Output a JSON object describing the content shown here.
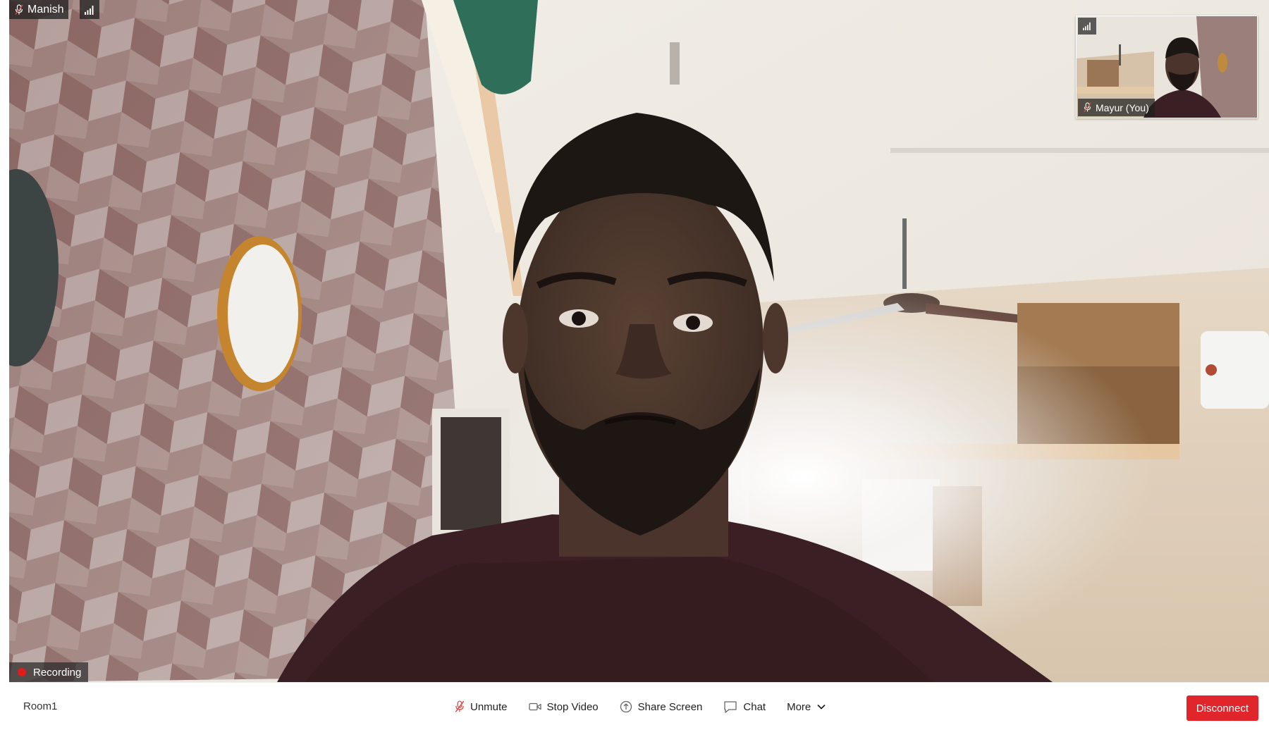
{
  "main_video": {
    "participant_name": "Manish",
    "recording_label": "Recording"
  },
  "self_view": {
    "participant_name": "Mayur (You)"
  },
  "toolbar": {
    "room_name": "Room1",
    "unmute_label": "Unmute",
    "stop_video_label": "Stop Video",
    "share_screen_label": "Share Screen",
    "chat_label": "Chat",
    "more_label": "More",
    "disconnect_label": "Disconnect"
  },
  "icons": {
    "mic": "mic-muted-icon",
    "video": "camera-icon",
    "share": "share-screen-icon",
    "chat": "chat-bubble-icon",
    "more": "chevron-down-icon",
    "signal": "signal-bars-icon"
  },
  "colors": {
    "disconnect": "#e0252b",
    "recording_dot": "#e21b1b",
    "muted_mic": "#d9534f"
  }
}
